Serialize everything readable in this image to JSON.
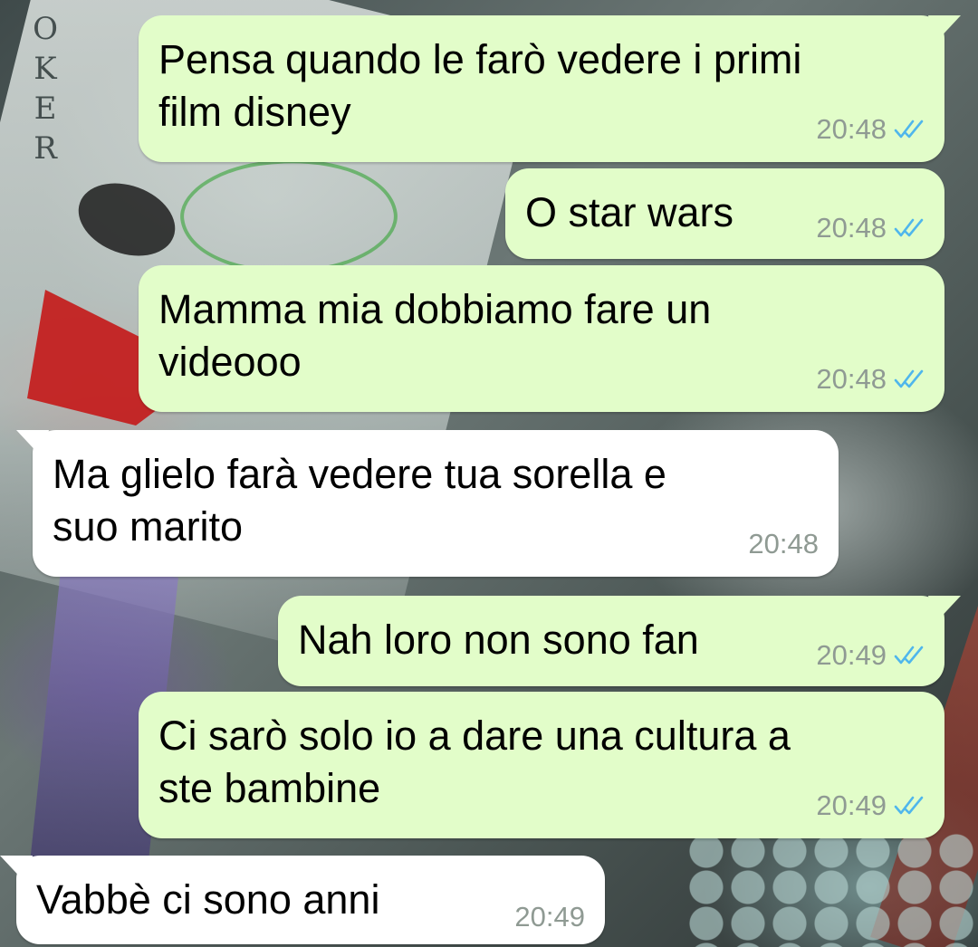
{
  "messages": [
    {
      "direction": "outgoing",
      "text": "Pensa quando le farò vedere i primi\nfilm disney",
      "time": "20:48",
      "status": "read"
    },
    {
      "direction": "outgoing",
      "text": "O star wars",
      "time": "20:48",
      "status": "read"
    },
    {
      "direction": "outgoing",
      "text": "Mamma mia dobbiamo fare un\nvideooo",
      "time": "20:48",
      "status": "read"
    },
    {
      "direction": "incoming",
      "text": "Ma glielo farà vedere tua sorella e\nsuo marito",
      "time": "20:48"
    },
    {
      "direction": "outgoing",
      "text": "Nah loro non sono fan",
      "time": "20:49",
      "status": "read"
    },
    {
      "direction": "outgoing",
      "text": "Ci sarò solo io a dare una cultura a\nste bambine",
      "time": "20:49",
      "status": "read"
    },
    {
      "direction": "incoming",
      "text": "Vabbè ci sono anni",
      "time": "20:49"
    }
  ],
  "colors": {
    "outgoing_bubble": "#e2fdc9",
    "incoming_bubble": "#ffffff",
    "read_ticks": "#4fb6ec",
    "timestamp": "#8f9a93"
  },
  "wallpaper": {
    "letters": [
      "O",
      "K",
      "E",
      "R"
    ]
  },
  "icons": {
    "read_status": "double-check-icon"
  }
}
